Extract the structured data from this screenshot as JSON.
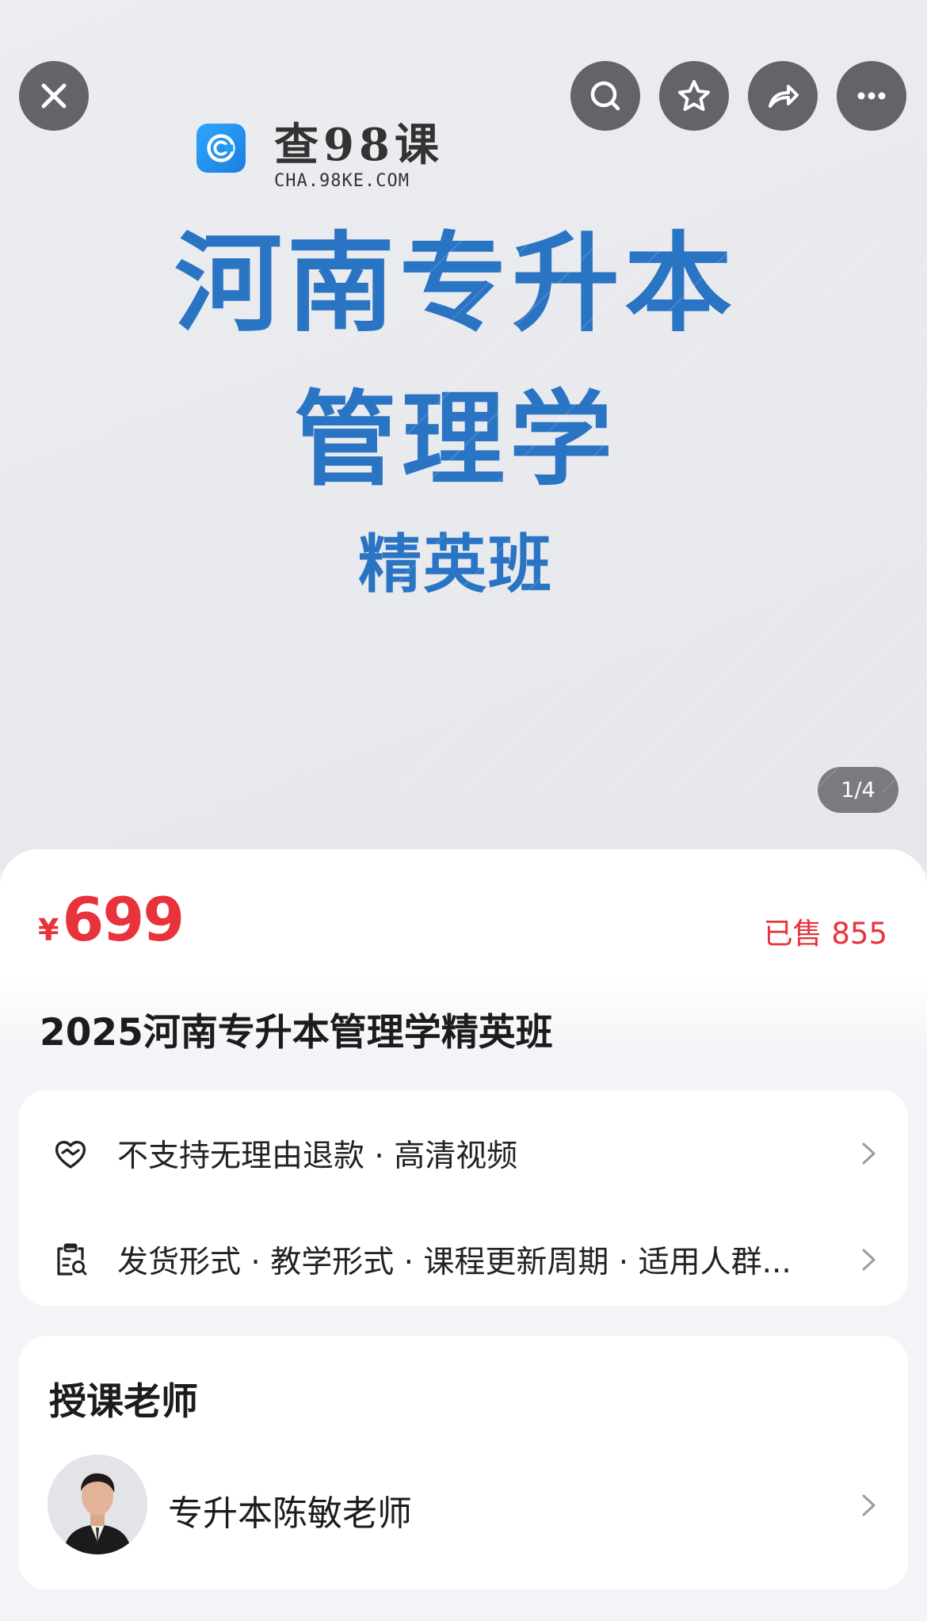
{
  "hero": {
    "brand": {
      "name": "查98课",
      "url": "CHA.98KE.COM"
    },
    "cover_lines": [
      "河南专升本",
      "管理学",
      "精英班"
    ],
    "pager": "1/4",
    "accent_color": "#2a74c4"
  },
  "toolbar": {
    "close": "close-icon",
    "search": "search-icon",
    "favorite": "star-icon",
    "share": "share-icon",
    "more": "more-icon"
  },
  "product": {
    "currency": "¥",
    "price": "699",
    "sold": "已售 855",
    "title": "2025河南专升本管理学精英班",
    "price_color": "#e8323c"
  },
  "info": {
    "rows": [
      {
        "icon": "heart-shield-icon",
        "text": "不支持无理由退款 · 高清视频"
      },
      {
        "icon": "clipboard-search-icon",
        "text": "发货形式 · 教学形式 · 课程更新周期 · 适用人群..."
      }
    ]
  },
  "teacher": {
    "heading": "授课老师",
    "name": "专升本陈敏老师"
  }
}
